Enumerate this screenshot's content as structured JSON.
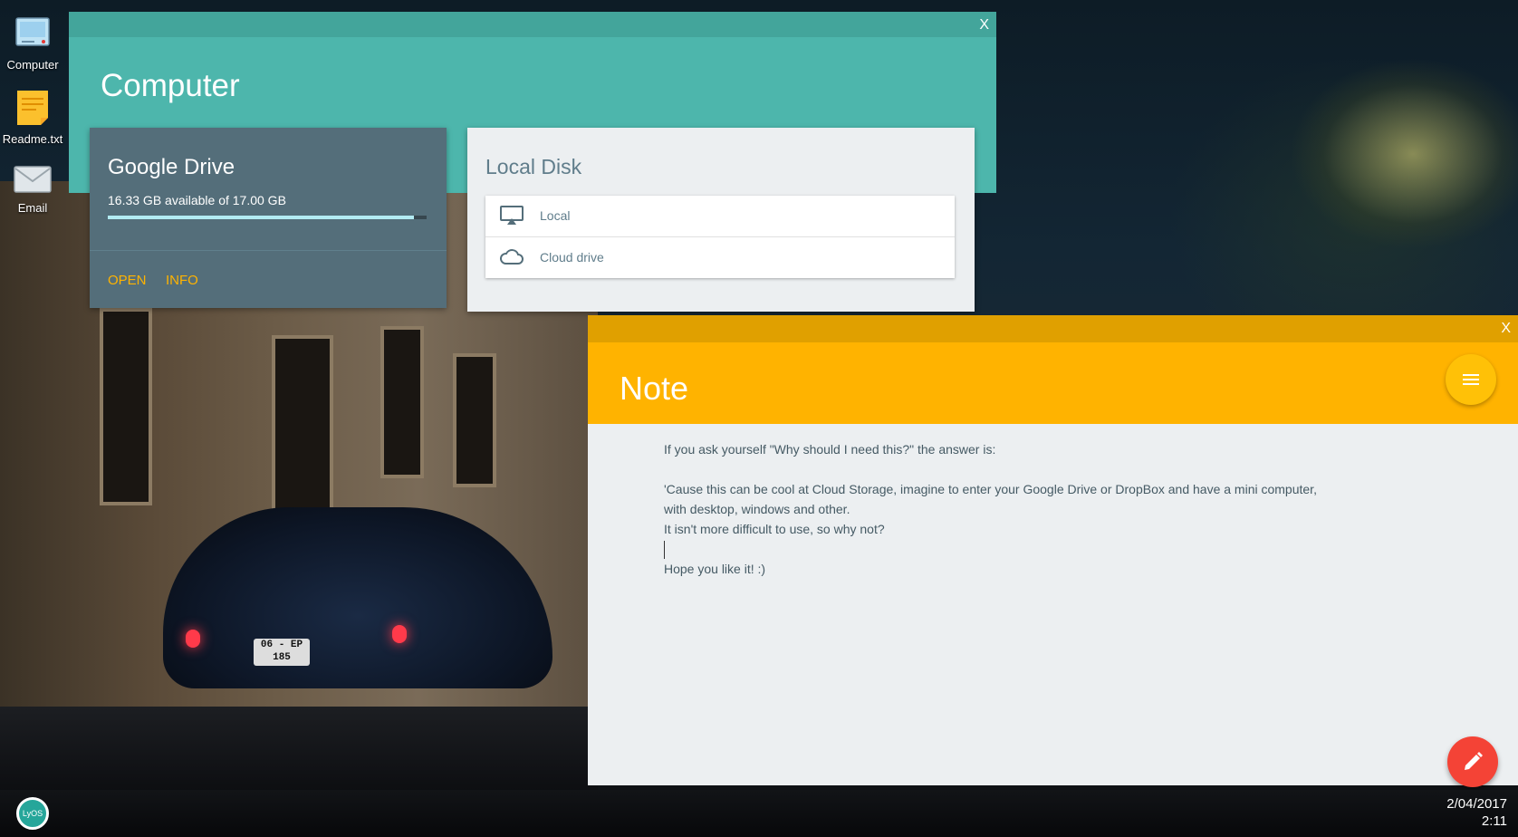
{
  "desktop": {
    "icons": [
      {
        "label": "Computer",
        "icon": "computer-icon"
      },
      {
        "label": "Readme.txt",
        "icon": "note-file-icon"
      },
      {
        "label": "Email",
        "icon": "email-icon"
      }
    ]
  },
  "computer_window": {
    "title": "Computer",
    "close_label": "X",
    "google_drive": {
      "title": "Google Drive",
      "storage_text": "16.33 GB available of 17.00 GB",
      "used_fraction": 0.96,
      "open_label": "OPEN",
      "info_label": "INFO"
    },
    "local_disk": {
      "title": "Local Disk",
      "items": [
        {
          "label": "Local",
          "icon": "airplay-monitor-icon"
        },
        {
          "label": "Cloud drive",
          "icon": "cloud-icon"
        }
      ]
    }
  },
  "note_window": {
    "title": "Note",
    "close_label": "X",
    "lines": [
      "If you ask yourself \"Why should I need this?\" the answer is:",
      "",
      "'Cause this can be cool at Cloud Storage, imagine to enter your Google Drive or DropBox and have a mini computer,",
      "with desktop, windows and other.",
      "It isn't more difficult to use, so why not?",
      "",
      "Hope you like it! :)"
    ]
  },
  "taskbar": {
    "start_label": "LyOS",
    "date": "2/04/2017",
    "time": "2:11"
  },
  "colors": {
    "computer_accent": "#4db6ac",
    "note_accent": "#ffb300",
    "card_dark": "#546e7a",
    "action_orange": "#ffb300",
    "fab_red": "#f44336"
  }
}
